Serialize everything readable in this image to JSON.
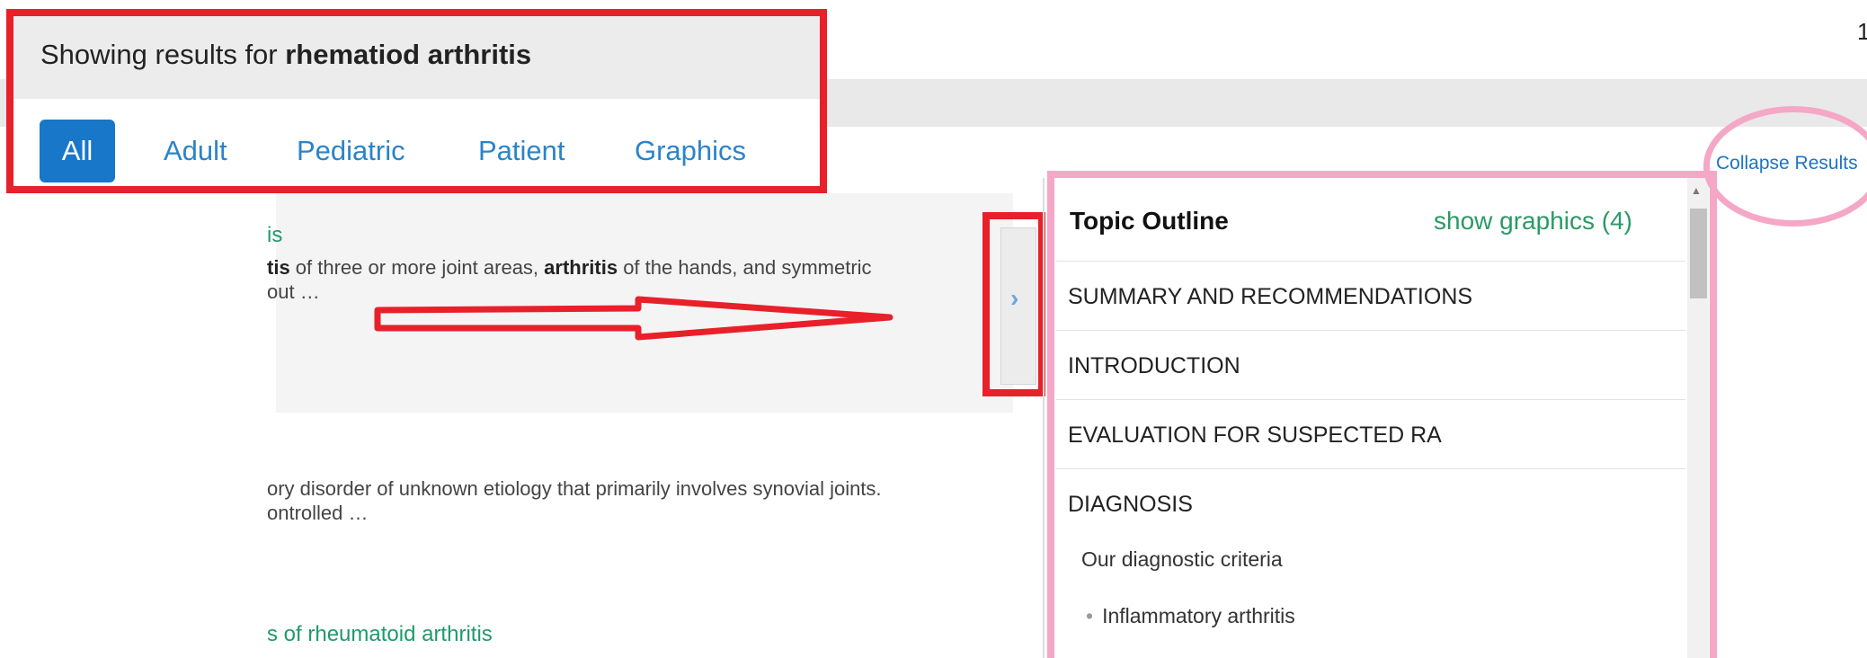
{
  "search": {
    "prefix": "Showing results for ",
    "query": "rhematiod arthritis"
  },
  "tabs": [
    {
      "label": "All",
      "active": true
    },
    {
      "label": "Adult"
    },
    {
      "label": "Pediatric"
    },
    {
      "label": "Patient"
    },
    {
      "label": "Graphics"
    }
  ],
  "results": [
    {
      "title": "is",
      "snippet_bold_start": "tis",
      "snippet_1": " of three or more joint areas, ",
      "snippet_bold_mid": "arthritis",
      "snippet_2": " of the hands, and symmetric",
      "snippet_line2": "out …"
    },
    {
      "snippet_line1": "ory disorder of unknown etiology that primarily involves synovial joints.",
      "snippet_line2": "ontrolled …"
    },
    {
      "title": "s of rheumatoid arthritis"
    }
  ],
  "outline": {
    "title": "Topic Outline",
    "show_graphics": "show graphics (4)",
    "items": [
      "SUMMARY AND RECOMMENDATIONS",
      "INTRODUCTION",
      "EVALUATION FOR SUSPECTED RA",
      "DIAGNOSIS"
    ],
    "sub": "Our diagnostic criteria",
    "bullet": "Inflammatory arthritis"
  },
  "collapse_label": "Collapse Results",
  "corner_mark": "1",
  "colors": {
    "highlight_red": "#e8202a",
    "highlight_pink": "#f5a7c6",
    "link_blue": "#2b84c8",
    "result_green": "#1f9a6a"
  }
}
